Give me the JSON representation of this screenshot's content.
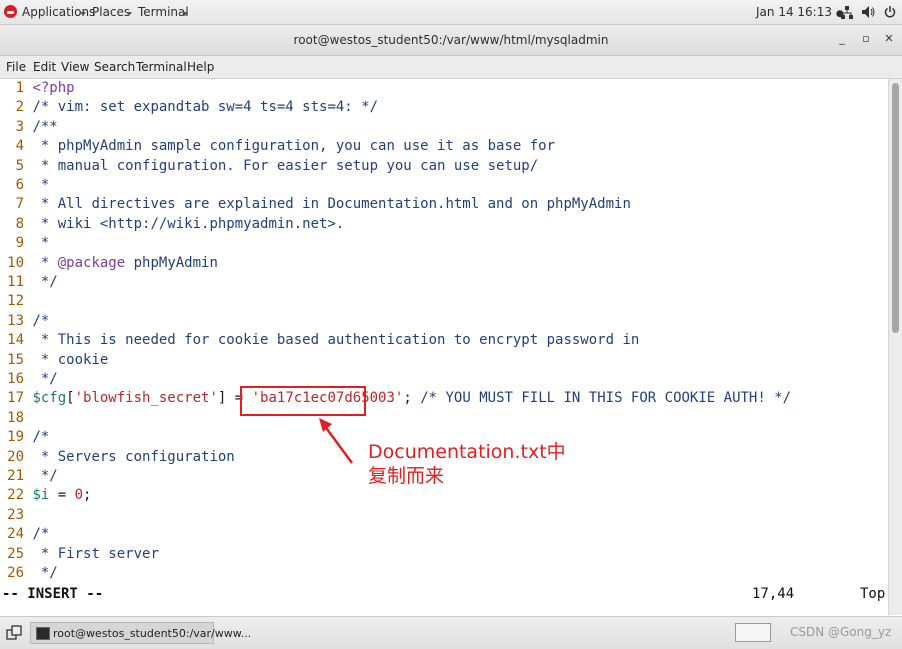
{
  "top_panel": {
    "applications": "Applications",
    "places": "Places",
    "terminal": "Terminal",
    "datetime": "Jan 14 16:13",
    "dot": "●"
  },
  "window": {
    "title": "root@westos_student50:/var/www/html/mysqladmin",
    "minimize": "_",
    "maximize": "▫",
    "close": "✕"
  },
  "menu": [
    "File",
    "Edit",
    "View",
    "Search",
    "Terminal",
    "Help"
  ],
  "editor": {
    "lines": [
      {
        "num": "1",
        "text": "<?php"
      },
      {
        "num": "2",
        "text": "/* vim: set expandtab sw=4 ts=4 sts=4: */"
      },
      {
        "num": "3",
        "text": "/**"
      },
      {
        "num": "4",
        "text": " * phpMyAdmin sample configuration, you can use it as base for"
      },
      {
        "num": "5",
        "text": " * manual configuration. For easier setup you can use setup/"
      },
      {
        "num": "6",
        "text": " *"
      },
      {
        "num": "7",
        "text": " * All directives are explained in Documentation.html and on phpMyAdmin"
      },
      {
        "num": "8",
        "text": " * wiki <http://wiki.phpmyadmin.net>."
      },
      {
        "num": "9",
        "text": " *"
      },
      {
        "num": "10",
        "text_a": " * ",
        "text_kw": "@package",
        "text_b": " phpMyAdmin"
      },
      {
        "num": "11",
        "text": " */"
      },
      {
        "num": "12",
        "text": ""
      },
      {
        "num": "13",
        "text": "/*"
      },
      {
        "num": "14",
        "text": " * This is needed for cookie based authentication to encrypt password in"
      },
      {
        "num": "15",
        "text": " * cookie"
      },
      {
        "num": "16",
        "text": " */"
      },
      {
        "num": "17",
        "var": "$cfg",
        "open": "[",
        "key": "'blowfish_secret'",
        "mid": "] = ",
        "q1": "'",
        "secret": "ba17c1ec07d65003",
        "q2": "'",
        "semi": ";",
        "comment": " /* YOU MUST FILL IN THIS FOR COOKIE AUTH! */"
      },
      {
        "num": "18",
        "text": ""
      },
      {
        "num": "19",
        "text": "/*"
      },
      {
        "num": "20",
        "text": " * Servers configuration"
      },
      {
        "num": "21",
        "text": " */"
      },
      {
        "num": "22",
        "var": "$i",
        "mid": " = ",
        "value": "0",
        "semi": ";"
      },
      {
        "num": "23",
        "text": ""
      },
      {
        "num": "24",
        "text": "/*"
      },
      {
        "num": "25",
        "text": " * First server"
      },
      {
        "num": "26",
        "text": " */"
      }
    ],
    "status": {
      "mode": "-- INSERT --",
      "position": "17,44",
      "percent": "Top"
    }
  },
  "annotation": {
    "line1": "Documentation.txt中",
    "line2": "复制而来",
    "color": "#e02020"
  },
  "taskbar": {
    "task_label": "root@westos_student50:/var/www...",
    "watermark": "CSDN @Gong_yz"
  }
}
